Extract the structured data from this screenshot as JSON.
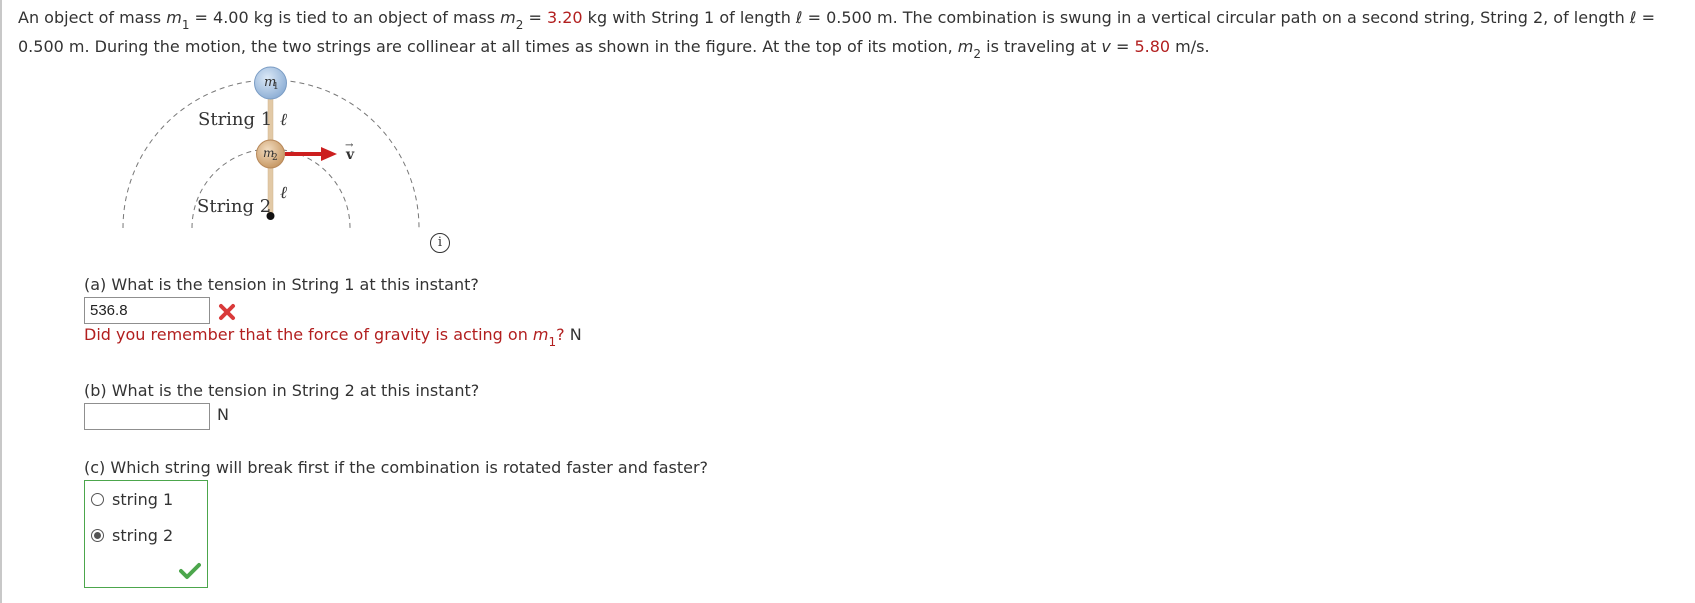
{
  "problem": {
    "p1": "An object of mass ",
    "m1_var": "m",
    "m1_sub": "1",
    "p2": " = 4.00 kg is tied to an object of mass ",
    "m2_var": "m",
    "m2_sub": "2",
    "p3": " = ",
    "m2_value": "3.20",
    "p4": " kg with String 1 of length ℓ = 0.500 m. The combination is swung in a vertical circular path on a second string, String 2, of length ℓ =",
    "line2_a": "0.500 m. During the motion, the two strings are collinear at all times as shown in the figure. At the top of its motion, ",
    "m2b_var": "m",
    "m2b_sub": "2",
    "line2_b": " is traveling at ",
    "v_var": "v",
    "line2_c": " = ",
    "v_value": "5.80",
    "line2_d": " m/s."
  },
  "figure": {
    "m1_label": "m",
    "m1_sub": "1",
    "m2_label": "m",
    "m2_sub": "2",
    "string1_label": "String 1",
    "string2_label": "String 2",
    "ell_upper": "ℓ",
    "ell_lower": "ℓ",
    "v_label": "v",
    "v_arrow": "→",
    "info_label": "i"
  },
  "part_a": {
    "question": "(a) What is the tension in String 1 at this instant?",
    "answer": "536.8",
    "feedback_text": "Did you remember that the force of gravity is acting on ",
    "feedback_var": "m",
    "feedback_sub": "1",
    "feedback_end": "?",
    "unit": " N"
  },
  "part_b": {
    "question": "(b) What is the tension in String 2 at this instant?",
    "answer": "",
    "unit": "N"
  },
  "part_c": {
    "question": "(c) Which string will break first if the combination is rotated faster and faster?",
    "option1": "string 1",
    "option2": "string 2",
    "selected": "string 2"
  },
  "colors": {
    "given_value_red": "#b21f1f",
    "incorrect_red": "#d93a3a",
    "correct_green": "#4ca64c",
    "force_arrow_red": "#cc1f1f"
  }
}
